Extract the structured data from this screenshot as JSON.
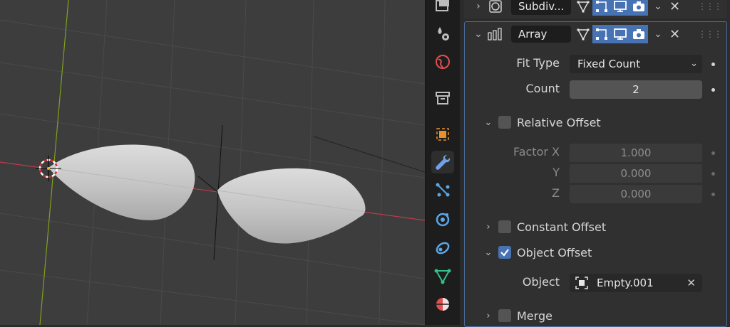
{
  "viewport": {
    "label": "3D Viewport"
  },
  "property_tabs": [
    {
      "name": "render-icon",
      "active": false
    },
    {
      "name": "physics-particles-icon",
      "active": false
    },
    {
      "name": "world-icon",
      "active": false
    },
    {
      "name": "collection-icon",
      "active": false
    },
    {
      "name": "object-icon",
      "active": false
    },
    {
      "name": "modifier-wrench-icon",
      "active": true
    },
    {
      "name": "particles-icon",
      "active": false
    },
    {
      "name": "physics-icon",
      "active": false
    },
    {
      "name": "constraints-icon",
      "active": false
    },
    {
      "name": "object-data-icon",
      "active": false
    },
    {
      "name": "material-icon",
      "active": false
    }
  ],
  "modifiers": {
    "subdiv": {
      "name": "Subdiv..."
    },
    "array": {
      "name": "Array",
      "fit_type_label": "Fit Type",
      "fit_type_value": "Fixed Count",
      "count_label": "Count",
      "count_value": "2",
      "relative_offset_label": "Relative Offset",
      "relative_offset_checked": false,
      "factor_x_label": "Factor X",
      "factor_x_value": "1.000",
      "y_label": "Y",
      "y_value": "0.000",
      "z_label": "Z",
      "z_value": "0.000",
      "constant_offset_label": "Constant Offset",
      "constant_offset_checked": false,
      "object_offset_label": "Object Offset",
      "object_offset_checked": true,
      "object_label": "Object",
      "object_value": "Empty.001",
      "merge_label": "Merge",
      "merge_checked": false
    }
  },
  "colors": {
    "accent": "#4772b3",
    "x_axis": "#c0394b",
    "y_axis": "#80a020"
  }
}
